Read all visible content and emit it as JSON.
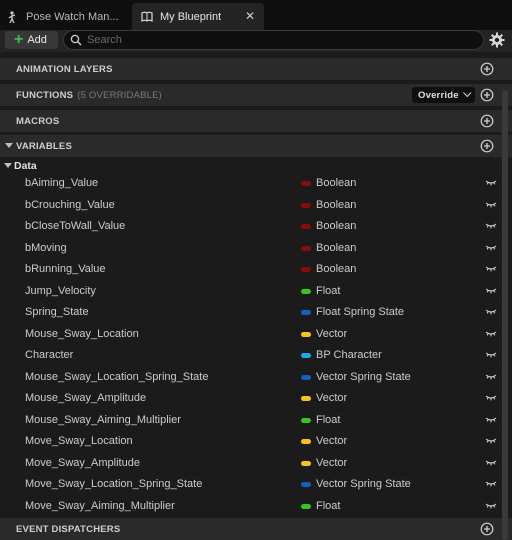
{
  "tabs": {
    "inactive_label": "Pose Watch Man...",
    "active_label": "My Blueprint"
  },
  "toolbar": {
    "add_label": "Add",
    "search_placeholder": "Search"
  },
  "sections": {
    "animation_layers": "ANIMATION LAYERS",
    "functions": "FUNCTIONS",
    "functions_sub": "(5 OVERRIDABLE)",
    "override_label": "Override",
    "macros": "MACROS",
    "variables": "VARIABLES",
    "event_dispatchers": "EVENT DISPATCHERS"
  },
  "category": {
    "label": "Data"
  },
  "colors": {
    "boolean": "#8c0a0a",
    "float": "#36c61d",
    "spring_state": "#1160c8",
    "vector": "#f6c21b",
    "bp_character": "#1ca7e8"
  },
  "variables": [
    {
      "name": "bAiming_Value",
      "type": "Boolean",
      "color": "#8c0a0a"
    },
    {
      "name": "bCrouching_Value",
      "type": "Boolean",
      "color": "#8c0a0a"
    },
    {
      "name": "bCloseToWall_Value",
      "type": "Boolean",
      "color": "#8c0a0a"
    },
    {
      "name": "bMoving",
      "type": "Boolean",
      "color": "#8c0a0a"
    },
    {
      "name": "bRunning_Value",
      "type": "Boolean",
      "color": "#8c0a0a"
    },
    {
      "name": "Jump_Velocity",
      "type": "Float",
      "color": "#36c61d"
    },
    {
      "name": "Spring_State",
      "type": "Float Spring State",
      "color": "#1160c8"
    },
    {
      "name": "Mouse_Sway_Location",
      "type": "Vector",
      "color": "#f6c21b"
    },
    {
      "name": "Character",
      "type": "BP Character",
      "color": "#1ca7e8"
    },
    {
      "name": "Mouse_Sway_Location_Spring_State",
      "type": "Vector Spring State",
      "color": "#1160c8"
    },
    {
      "name": "Mouse_Sway_Amplitude",
      "type": "Vector",
      "color": "#f6c21b"
    },
    {
      "name": "Mouse_Sway_Aiming_Multiplier",
      "type": "Float",
      "color": "#36c61d"
    },
    {
      "name": "Move_Sway_Location",
      "type": "Vector",
      "color": "#f6c21b"
    },
    {
      "name": "Move_Sway_Amplitude",
      "type": "Vector",
      "color": "#f6c21b"
    },
    {
      "name": "Move_Sway_Location_Spring_State",
      "type": "Vector Spring State",
      "color": "#1160c8"
    },
    {
      "name": "Move_Sway_Aiming_Multiplier",
      "type": "Float",
      "color": "#36c61d"
    }
  ]
}
